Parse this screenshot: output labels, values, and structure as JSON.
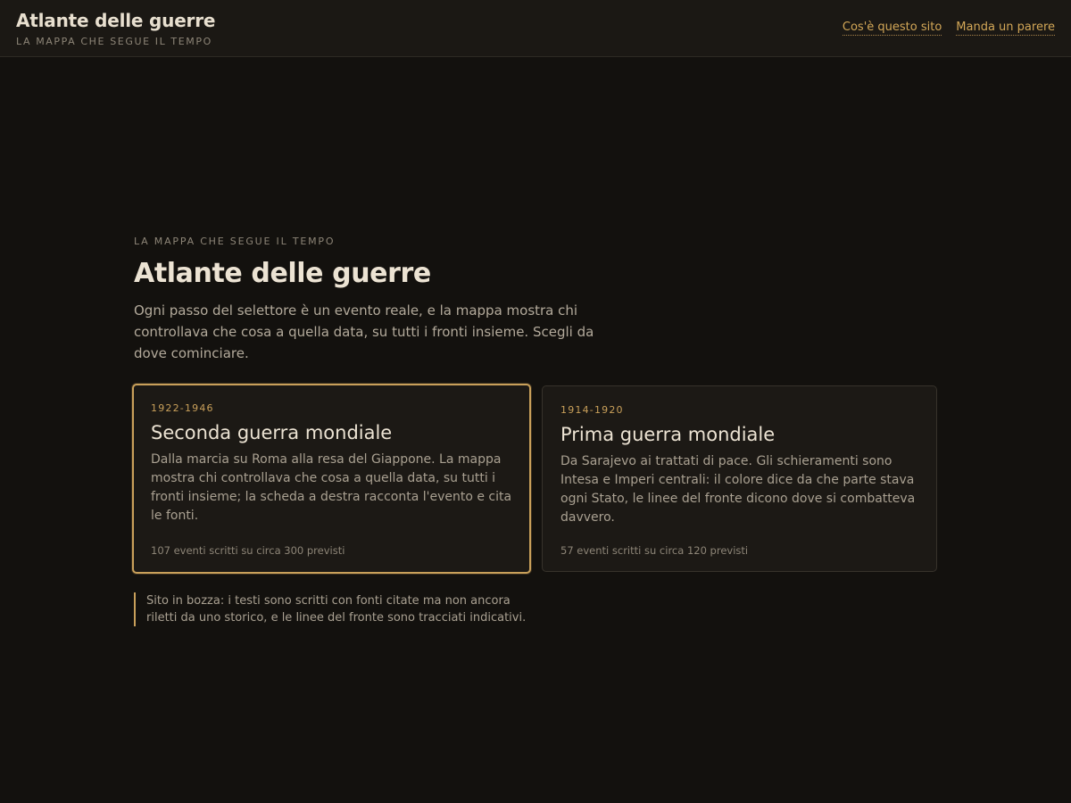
{
  "header": {
    "title": "Atlante delle guerre",
    "subtitle": "LA MAPPA CHE SEGUE IL TEMPO",
    "nav": [
      {
        "label": "Cos'è questo sito"
      },
      {
        "label": "Manda un parere"
      }
    ]
  },
  "hero": {
    "eyebrow": "LA MAPPA CHE SEGUE IL TEMPO",
    "title": "Atlante delle guerre",
    "description": "Ogni passo del selettore è un evento reale, e la mappa mostra chi controllava che cosa a quella data, su tutti i fronti insieme. Scegli da dove cominciare."
  },
  "cards": [
    {
      "years": "1922-1946",
      "title": "Seconda guerra mondiale",
      "text": "Dalla marcia su Roma alla resa del Giappone. La mappa mostra chi controllava che cosa a quella data, su tutti i fronti insieme; la scheda a destra racconta l'evento e cita le fonti.",
      "count": "107 eventi scritti su circa 300 previsti",
      "selected": true
    },
    {
      "years": "1914-1920",
      "title": "Prima guerra mondiale",
      "text": "Da Sarajevo ai trattati di pace. Gli schieramenti sono Intesa e Imperi centrali: il colore dice da che parte stava ogni Stato, le linee del fronte dicono dove si combatteva davvero.",
      "count": "57 eventi scritti su circa 120 previsti",
      "selected": false
    }
  ],
  "note": "Sito in bozza: i testi sono scritti con fonti citate ma non ancora riletti da uno storico, e le linee del fronte sono tracciati indicativi.",
  "colors": {
    "background": "#13110e",
    "accent": "#c9a05a",
    "link": "#d3a757"
  }
}
